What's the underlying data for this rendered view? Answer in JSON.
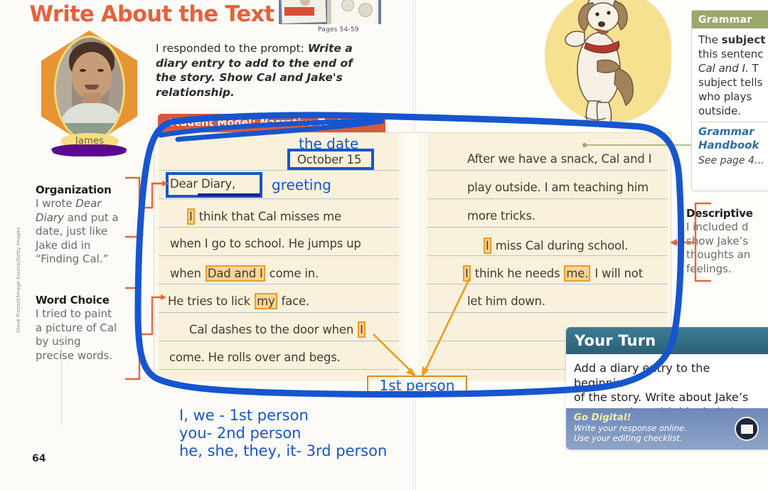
{
  "header": {
    "title": "Write About the Text",
    "pages_caption": "Pages 54-59",
    "student_name": "James"
  },
  "prompt": {
    "lead": "I responded to the prompt:",
    "italic": "Write a diary entry to add to the end of the story. Show Cal and Jake's relationship."
  },
  "student_model": {
    "label": "Student Model:",
    "genre": "Narrative Text"
  },
  "writing": {
    "date": "October 15",
    "greeting": "Dear Diary,",
    "left_lines": [
      "I think that Cal misses me",
      "when I go to school. He jumps up",
      "when Dad and I come in.",
      "He tries to lick my face.",
      "Cal dashes to the door when I",
      "come. He rolls over and begs."
    ],
    "right_lines": [
      "After we have a snack, Cal and I",
      "play outside. I am teaching him",
      "more tricks.",
      "I miss Cal during school.",
      "I think he needs me. I will not",
      "let him down."
    ]
  },
  "annotations": {
    "the_date": "the date",
    "greeting": "greeting",
    "first_person": "1st person",
    "legend": [
      "I, we - 1st person",
      "you- 2nd person",
      "he, she, they, it- 3rd person"
    ],
    "pen_color": "#1755cf",
    "highlight_border": "#ef9b21",
    "highlight_fill": "#f9d49a"
  },
  "callouts": [
    {
      "title": "Organization",
      "body": "I wrote Dear Diary and put a date, just like Jake did in “Finding Cal.”"
    },
    {
      "title": "Word Choice",
      "body": "I tried to paint a picture of Cal by using precise words."
    },
    {
      "title": "Descriptive",
      "body": "I included d… show Jake’s thoughts an… feelings."
    }
  ],
  "grammar": {
    "heading": "Grammar",
    "body": "The subject… this sentenc… Cal and I. T… subject tells… who plays outside.",
    "handbook": "Grammar Handbook",
    "see_page": "See page 4…"
  },
  "your_turn": {
    "heading": "Your Turn",
    "body": "Add a diary entry to the beginnin… of the story. Write about Jake’s conversation with his dad about c…",
    "go_digital": "Go Digital!",
    "line1": "Write your response online.",
    "line2": "Use your editing checklist."
  },
  "footer": {
    "page_number": "64",
    "credit": "Steve Prezant/Image Source/Getty Images"
  },
  "colors": {
    "title": "#e8603c",
    "banner": "#d8593a",
    "grammar_header": "#9aa86b",
    "your_turn_header": "#2b6075",
    "paper": "#f9f1dc"
  }
}
